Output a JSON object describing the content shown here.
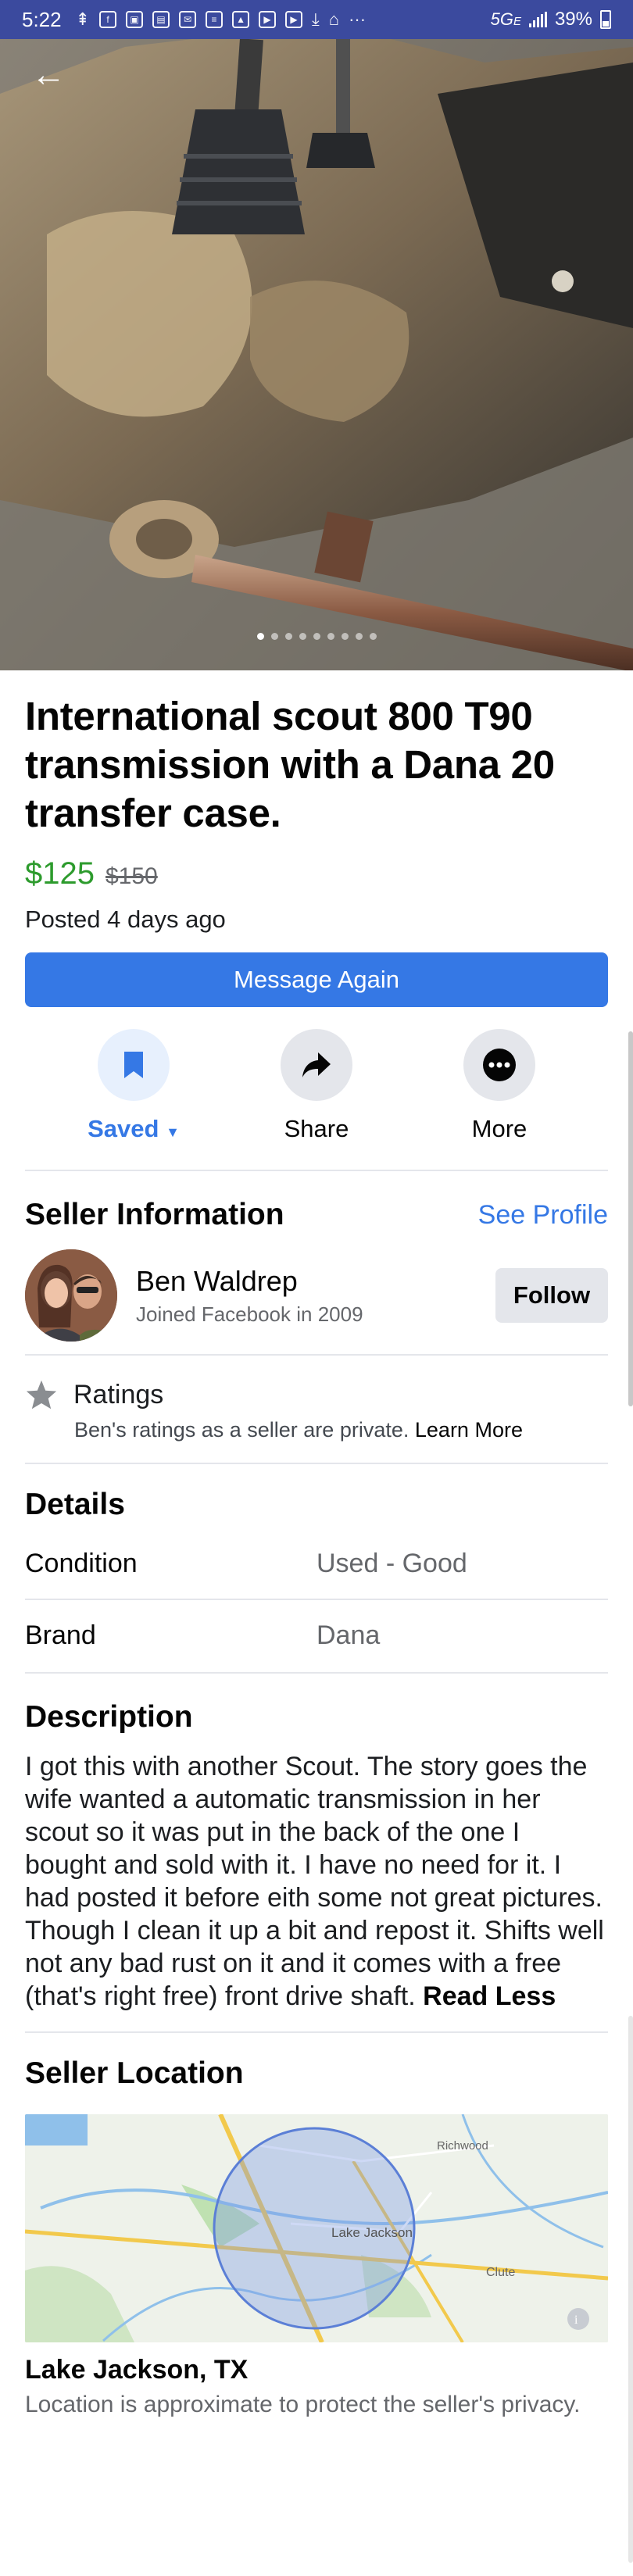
{
  "status_bar": {
    "time": "5:22",
    "network": "5G",
    "network_sub": "E",
    "battery": "39%"
  },
  "listing": {
    "title": "International scout 800 T90 transmission with a Dana 20 transfer case.",
    "price": "$125",
    "old_price": "$150",
    "posted": "Posted 4 days ago",
    "message_button": "Message Again",
    "photo_count": 9,
    "active_photo": 1
  },
  "actions": {
    "saved": "Saved",
    "share": "Share",
    "more": "More"
  },
  "seller": {
    "section_title": "Seller Information",
    "see_profile": "See Profile",
    "name": "Ben Waldrep",
    "joined": "Joined Facebook in 2009",
    "follow": "Follow"
  },
  "ratings": {
    "title": "Ratings",
    "text": "Ben's ratings as a seller are private.",
    "learn_more": "Learn More"
  },
  "details": {
    "title": "Details",
    "rows": [
      {
        "key": "Condition",
        "value": "Used - Good"
      },
      {
        "key": "Brand",
        "value": "Dana"
      }
    ]
  },
  "description": {
    "title": "Description",
    "text": "I got this with another Scout. The story goes the wife wanted a automatic transmission in her scout so it was put in the back of the one I bought and sold with it. I have no need for it. I had posted it before eith some not great pictures. Though I clean it up a bit and repost it. Shifts well not any bad rust on it and it comes with a free (that's right free) front drive shaft.",
    "read_less": "Read Less"
  },
  "location": {
    "title": "Seller Location",
    "map_labels": {
      "richwood": "Richwood",
      "lake_jackson": "Lake Jackson",
      "clute": "Clute"
    },
    "name": "Lake Jackson, TX",
    "note": "Location is approximate to protect the seller's privacy."
  },
  "colors": {
    "accent": "#3578e5",
    "price": "#2d9b2d",
    "status_bar": "#3b4a9e"
  }
}
